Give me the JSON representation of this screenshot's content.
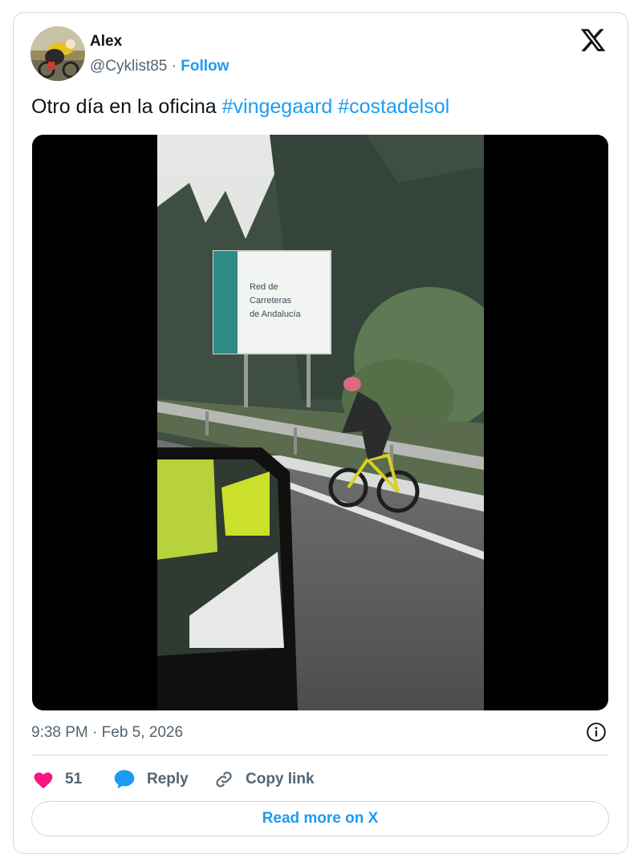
{
  "author": {
    "name": "Alex",
    "handle": "@Cyklist85",
    "separator": " · ",
    "follow_label": "Follow"
  },
  "brand": {
    "logo": "x-logo",
    "color": "#0f1419"
  },
  "tweet": {
    "text": "Otro día en la oficina ",
    "hashtags": [
      "#vingegaard",
      "#costadelsol"
    ]
  },
  "media": {
    "type": "video",
    "sign_text": [
      "Red de",
      "Carreteras",
      "de Andalucía"
    ]
  },
  "timestamp": "9:38 PM · Feb 5, 2026",
  "actions": {
    "like_count": "51",
    "reply_label": "Reply",
    "copy_label": "Copy link"
  },
  "read_more_label": "Read more on X",
  "colors": {
    "accent": "#1d9bf0",
    "like": "#f91880",
    "text_secondary": "#536471",
    "border": "#cfd9de"
  }
}
